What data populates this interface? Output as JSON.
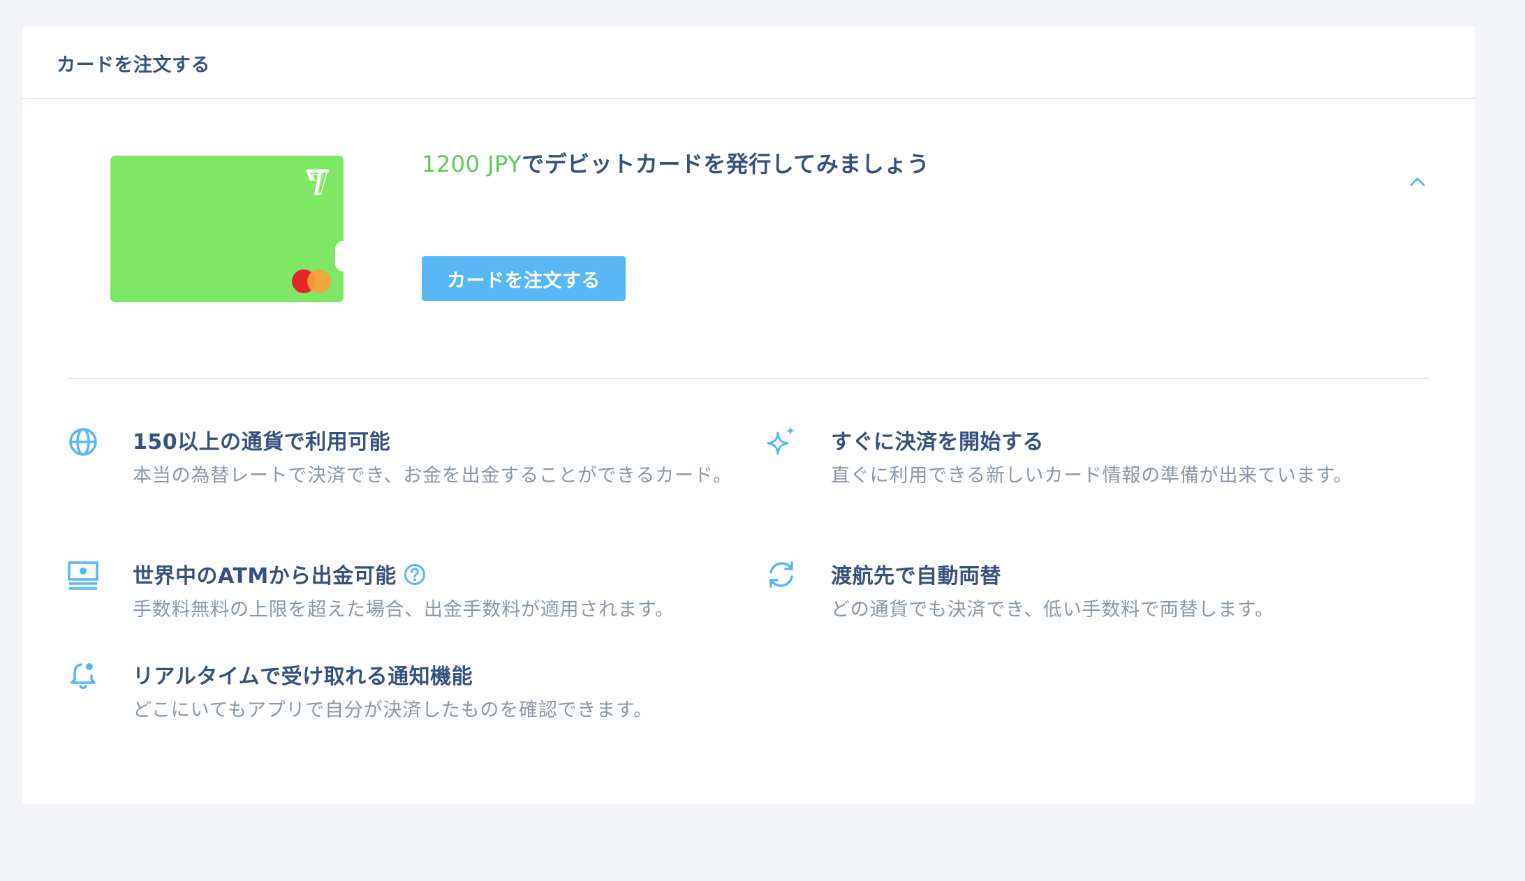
{
  "panel": {
    "title": "カードを注文する"
  },
  "offer": {
    "amount": "1200 JPY",
    "headline_rest": "でデビットカードを発行してみましょう",
    "order_button_label": "カードを注文する",
    "toggle_icon": "chevron-up-icon"
  },
  "card": {
    "color": "#7ee866",
    "logo_icon": "wise-flag-icon",
    "network_icon": "mastercard-icon"
  },
  "features": [
    {
      "icon": "globe-icon",
      "title": "150以上の通貨で利用可能",
      "description": "本当の為替レートで決済でき、お金を出金することができるカード。"
    },
    {
      "icon": "sparkle-icon",
      "title": "すぐに決済を開始する",
      "description": "直ぐに利用できる新しいカード情報の準備が出来ています。"
    },
    {
      "icon": "cash-icon",
      "title": "世界中のATMから出金可能",
      "description": "手数料無料の上限を超えた場合、出金手数料が適用されます。",
      "help_icon": "question-circle-icon"
    },
    {
      "icon": "refresh-icon",
      "title": "渡航先で自動両替",
      "description": "どの通貨でも決済でき、低い手数料で両替します。"
    },
    {
      "icon": "bell-icon",
      "title": "リアルタイムで受け取れる通知機能",
      "description": "どこにいてもアプリで自分が決済したものを確認できます。"
    }
  ],
  "colors": {
    "accent": "#58b8f5",
    "title_text": "#37517e",
    "muted_text": "#8a97a8",
    "amount_green": "#5fc85d"
  }
}
